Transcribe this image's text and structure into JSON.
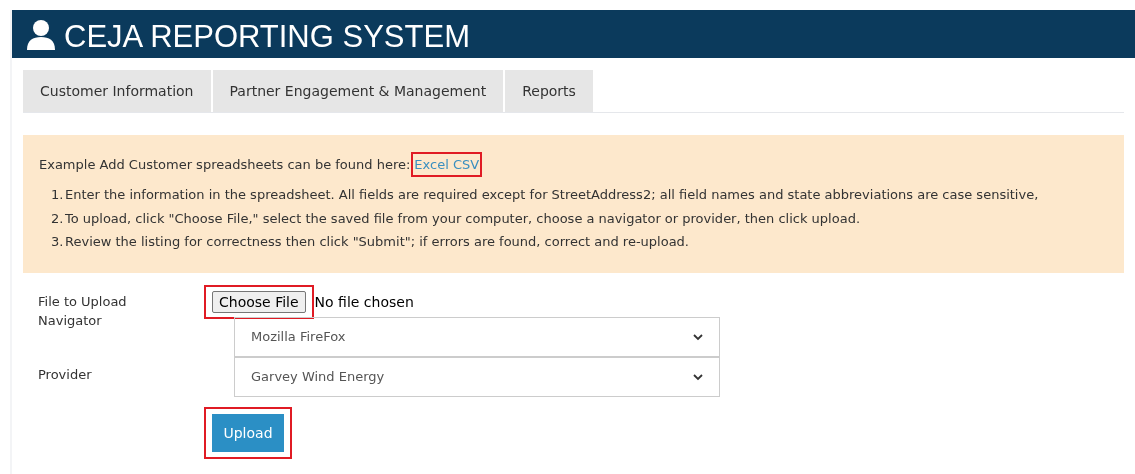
{
  "header": {
    "title": "CEJA REPORTING SYSTEM"
  },
  "tabs": [
    {
      "label": "Customer Information",
      "selected": false
    },
    {
      "label": "Partner Engagement & Management",
      "selected": false
    },
    {
      "label": "Reports",
      "selected": false
    }
  ],
  "notice": {
    "intro": "Example Add Customer spreadsheets can be found here:",
    "link": {
      "label": "Excel CSV",
      "highlighted": true
    },
    "steps": [
      "Enter the information in the spreadsheet. All fields are required except for StreetAddress2; all field names and state abbreviations are case sensitive,",
      "To upload, click \"Choose File,\" select the saved file from your computer, choose a navigator or provider, then click upload.",
      "Review the listing for correctness then click \"Submit\"; if errors are found, correct and re-upload."
    ],
    "numbers": [
      "1.",
      "2.",
      "3."
    ]
  },
  "form": {
    "file": {
      "label": "File to Upload",
      "button": "Choose File",
      "status": "No file chosen",
      "highlighted": true
    },
    "selects": [
      {
        "label": "Navigator",
        "value": "Mozilla FireFox"
      },
      {
        "label": "Provider",
        "value": "Garvey Wind Energy"
      }
    ],
    "submit": {
      "label": "Upload",
      "highlighted": true
    }
  }
}
